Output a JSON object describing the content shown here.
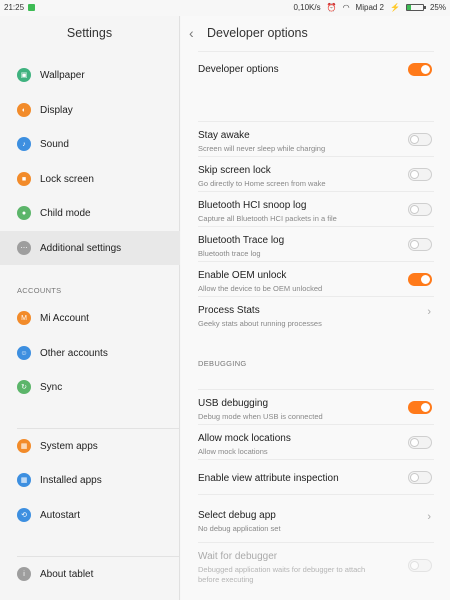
{
  "status_bar": {
    "time": "21:25",
    "speed": "0,10K/s",
    "network": "Mipad 2",
    "battery": "25%",
    "battery_level": 0.25
  },
  "sidebar": {
    "title": "Settings",
    "items": [
      {
        "label": "Wallpaper",
        "icon": "wallpaper-icon",
        "color": "#3fb27f"
      },
      {
        "label": "Display",
        "icon": "display-icon",
        "color": "#f28b2a"
      },
      {
        "label": "Sound",
        "icon": "sound-icon",
        "color": "#3d8fe0"
      },
      {
        "label": "Lock screen",
        "icon": "lock-icon",
        "color": "#f28b2a"
      },
      {
        "label": "Child mode",
        "icon": "child-mode-icon",
        "color": "#5cb56a"
      },
      {
        "label": "Additional settings",
        "icon": "more-icon",
        "color": "#9e9e9e"
      }
    ],
    "accounts_header": "ACCOUNTS",
    "account_items": [
      {
        "label": "Mi Account",
        "icon": "mi-account-icon",
        "color": "#f28b2a"
      },
      {
        "label": "Other accounts",
        "icon": "accounts-icon",
        "color": "#3d8fe0"
      },
      {
        "label": "Sync",
        "icon": "sync-icon",
        "color": "#5cb56a"
      }
    ],
    "app_items": [
      {
        "label": "System apps",
        "icon": "system-apps-icon",
        "color": "#f28b2a"
      },
      {
        "label": "Installed apps",
        "icon": "installed-apps-icon",
        "color": "#3d8fe0"
      },
      {
        "label": "Autostart",
        "icon": "autostart-icon",
        "color": "#3d8fe0"
      }
    ],
    "about": {
      "label": "About tablet",
      "icon": "about-icon",
      "color": "#9e9e9e"
    }
  },
  "main": {
    "title": "Developer options",
    "master": {
      "label": "Developer options",
      "state": "on"
    },
    "options": [
      {
        "title": "Stay awake",
        "subtitle": "Screen will never sleep while charging",
        "control": "toggle",
        "state": "off"
      },
      {
        "title": "Skip screen lock",
        "subtitle": "Go directly to Home screen from wake",
        "control": "toggle",
        "state": "off"
      },
      {
        "title": "Bluetooth HCI snoop log",
        "subtitle": "Capture all Bluetooth HCI packets in a file",
        "control": "toggle",
        "state": "off"
      },
      {
        "title": "Bluetooth Trace log",
        "subtitle": "Bluetooth trace log",
        "control": "toggle",
        "state": "off"
      },
      {
        "title": "Enable OEM unlock",
        "subtitle": "Allow the device to be OEM unlocked",
        "control": "toggle",
        "state": "on"
      },
      {
        "title": "Process Stats",
        "subtitle": "Geeky stats about running processes",
        "control": "chevron"
      }
    ],
    "debugging_header": "DEBUGGING",
    "debug_options": [
      {
        "title": "USB debugging",
        "subtitle": "Debug mode when USB is connected",
        "control": "toggle",
        "state": "on"
      },
      {
        "title": "Allow mock locations",
        "subtitle": "Allow mock locations",
        "control": "toggle",
        "state": "off"
      },
      {
        "title": "Enable view attribute inspection",
        "subtitle": "",
        "control": "toggle",
        "state": "off"
      },
      {
        "title": "Select debug app",
        "subtitle": "No debug application set",
        "control": "chevron"
      },
      {
        "title": "Wait for debugger",
        "subtitle": "Debugged application waits for debugger to attach",
        "subtitle2": "before executing",
        "control": "toggle",
        "state": "off",
        "disabled": true
      }
    ]
  },
  "colors": {
    "accent": "#ff7a1a"
  }
}
